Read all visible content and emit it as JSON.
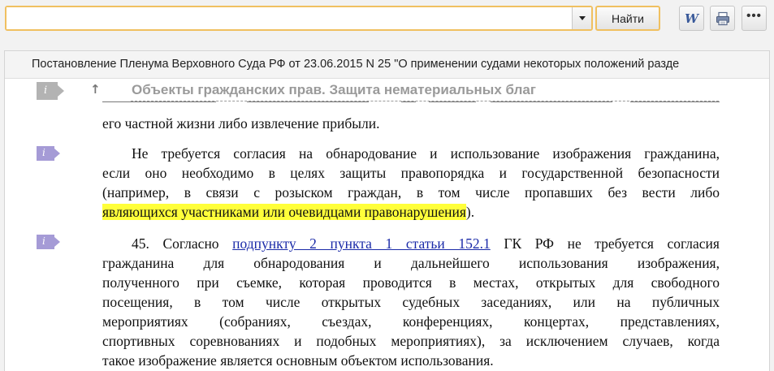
{
  "toolbar": {
    "search_value": "",
    "find_label": "Найти",
    "word_icon": "word-export-icon",
    "print_icon": "print-icon",
    "more_icon": "more-icon"
  },
  "document": {
    "title": "Постановление Пленума Верховного Суда РФ от 23.06.2015 N 25 \"О применении судами некоторых положений разде",
    "section_title": "Объекты гражданских прав. Защита нематериальных благ",
    "marker_letter": "i"
  },
  "paragraphs": {
    "p0": {
      "line1": "его частной жизни либо извлечение прибыли."
    },
    "p1": {
      "line1": "Не требуется согласия на обнародование и использование изображения гражданина,",
      "line2": "если оно необходимо в целях защиты правопорядка и государственной безопасности",
      "line3": "(например, в связи с розыском граждан, в том числе пропавших без вести либо",
      "line4_highlight": "являющихся участниками или очевидцами правонарушения",
      "line4_tail": ")."
    },
    "p2": {
      "line1_start": "45. Согласно ",
      "line1_link": "подпункту 2 пункта 1 статьи 152.1",
      "line1_end": " ГК РФ не требуется согласия",
      "line2": "гражданина для обнародования и дальнейшего использования изображения,",
      "line3": "полученного при съемке, которая проводится в местах, открытых для свободного",
      "line4": "посещения, в том числе открытых судебных заседаниях, или на публичных",
      "line5": "мероприятиях (собраниях, съездах, конференциях, концертах, представлениях,",
      "line6": "спортивных соревнованиях и подобных мероприятиях), за исключением случаев, когда",
      "line7": "такое изображение является основным объектом использования."
    }
  },
  "colors": {
    "accent_border": "#f0c060",
    "highlight": "#ffff3a",
    "link": "#1a2aa8",
    "marker_purple": "#a59bd6",
    "marker_grey": "#b3b3b3"
  }
}
